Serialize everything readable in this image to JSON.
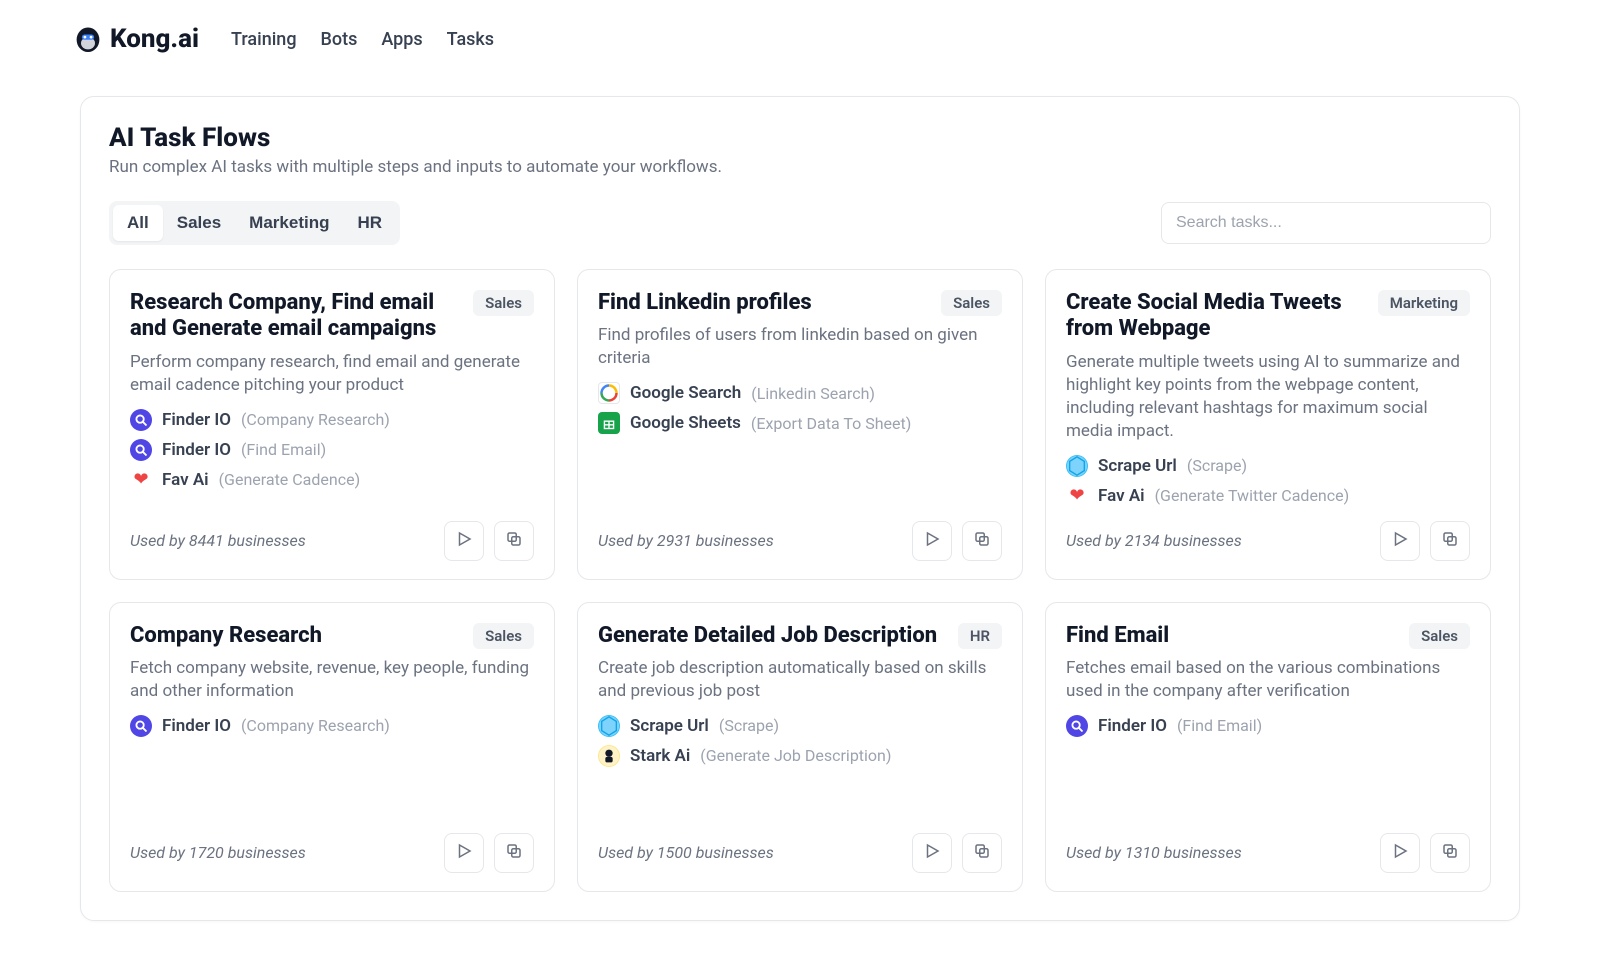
{
  "brand": "Kong.ai",
  "nav": [
    "Training",
    "Bots",
    "Apps",
    "Tasks"
  ],
  "page": {
    "title": "AI Task Flows",
    "subtitle": "Run complex AI tasks with multiple steps and inputs to automate your workflows."
  },
  "tabs": [
    "All",
    "Sales",
    "Marketing",
    "HR"
  ],
  "active_tab": "All",
  "search_placeholder": "Search tasks...",
  "cards": [
    {
      "title": "Research Company, Find email and Generate email campaigns",
      "badge": "Sales",
      "desc": "Perform company research, find email and generate email cadence pitching your product",
      "steps": [
        {
          "icon": "finder",
          "name": "Finder IO",
          "sub": "(Company Research)"
        },
        {
          "icon": "finder",
          "name": "Finder IO",
          "sub": "(Find Email)"
        },
        {
          "icon": "heart",
          "name": "Fav Ai",
          "sub": "(Generate Cadence)"
        }
      ],
      "usage": "Used by 8441 businesses"
    },
    {
      "title": "Find Linkedin profiles",
      "badge": "Sales",
      "desc": "Find profiles of users from linkedin based on given criteria",
      "steps": [
        {
          "icon": "gsearch",
          "name": "Google Search",
          "sub": "(Linkedin Search)"
        },
        {
          "icon": "gsheets",
          "name": "Google Sheets",
          "sub": "(Export Data To Sheet)"
        }
      ],
      "usage": "Used by 2931 businesses"
    },
    {
      "title": "Create Social Media Tweets from Webpage",
      "badge": "Marketing",
      "desc": "Generate multiple tweets using AI to summarize and highlight key points from the webpage content, including relevant hashtags for maximum social media impact.",
      "steps": [
        {
          "icon": "scrape",
          "name": "Scrape Url",
          "sub": "(Scrape)"
        },
        {
          "icon": "heart",
          "name": "Fav Ai",
          "sub": "(Generate Twitter Cadence)"
        }
      ],
      "usage": "Used by 2134 businesses"
    },
    {
      "title": "Company Research",
      "badge": "Sales",
      "desc": "Fetch company website, revenue, key people, funding and other information",
      "steps": [
        {
          "icon": "finder",
          "name": "Finder IO",
          "sub": "(Company Research)"
        }
      ],
      "usage": "Used by 1720 businesses"
    },
    {
      "title": "Generate Detailed Job Description",
      "badge": "HR",
      "desc": "Create job description automatically based on skills and previous job post",
      "steps": [
        {
          "icon": "scrape",
          "name": "Scrape Url",
          "sub": "(Scrape)"
        },
        {
          "icon": "stark",
          "name": "Stark Ai",
          "sub": "(Generate Job Description)"
        }
      ],
      "usage": "Used by 1500 businesses"
    },
    {
      "title": "Find Email",
      "badge": "Sales",
      "desc": "Fetches email based on the various combinations used in the company after verification",
      "steps": [
        {
          "icon": "finder",
          "name": "Finder IO",
          "sub": "(Find Email)"
        }
      ],
      "usage": "Used by 1310 businesses"
    }
  ]
}
